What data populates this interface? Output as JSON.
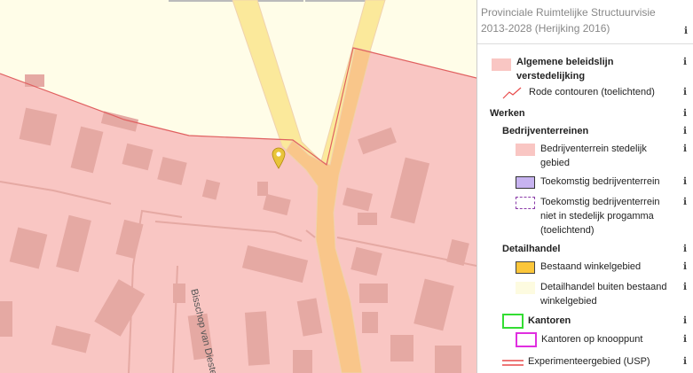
{
  "panel": {
    "title": "Provinciale Ruimtelijke Structuurvisie 2013-2028 (Herijking 2016)",
    "info_glyph": "ℹ"
  },
  "legend": [
    {
      "id": "beleidslijn",
      "label": "Algemene beleidslijn verstedelijking",
      "bold": true,
      "swatch": "fill",
      "color": "#f9c6c3"
    },
    {
      "id": "rode-contouren",
      "label": "Rode contouren (toelichtend)",
      "bold": false,
      "swatch": "line",
      "color": "#e84a4a"
    },
    {
      "id": "werken",
      "label": "Werken",
      "bold": true,
      "swatch": "none"
    },
    {
      "id": "bedrijventerreinen",
      "label": "Bedrijventerreinen",
      "bold": true,
      "swatch": "none"
    },
    {
      "id": "bedrijventerrein-stedelijk",
      "label": "Bedrijventerrein stedelijk gebied",
      "bold": false,
      "swatch": "fill",
      "color": "#f9c6c3"
    },
    {
      "id": "toekomstig-bedrijventerrein",
      "label": "Toekomstig bedrijventerrein",
      "bold": false,
      "swatch": "fill-border",
      "color": "#c7b3f0",
      "border": "#333333"
    },
    {
      "id": "toekomstig-niet-stedelijk",
      "label": "Toekomstig bedrijventerrein niet in stedelijk progamma (toelichtend)",
      "bold": false,
      "swatch": "dashed",
      "color": "#8a3ba8"
    },
    {
      "id": "detailhandel",
      "label": "Detailhandel",
      "bold": true,
      "swatch": "none"
    },
    {
      "id": "bestaand-winkelgebied",
      "label": "Bestaand winkelgebied",
      "bold": false,
      "swatch": "fill-border",
      "color": "#fbc63a",
      "border": "#444444"
    },
    {
      "id": "detailhandel-buiten",
      "label": "Detailhandel buiten bestaand winkelgebied",
      "bold": false,
      "swatch": "fill",
      "color": "#fdfbe0"
    },
    {
      "id": "kantoren",
      "label": "Kantoren",
      "bold": true,
      "swatch": "outline",
      "color": "#33dd33"
    },
    {
      "id": "kantoren-knooppunt",
      "label": "Kantoren op knooppunt",
      "bold": false,
      "swatch": "outline",
      "color": "#e02ee0"
    },
    {
      "id": "experimenteergebied",
      "label": "Experimenteergebied (USP)",
      "bold": false,
      "swatch": "double-line",
      "color": "#e84a4a"
    }
  ],
  "map": {
    "street_label": "Bisschop van Dieste",
    "colors": {
      "base": "#fffde8",
      "zone": "#f9c6c3",
      "contour": "#e06060",
      "building": "#e5a9a3",
      "road_yellow": "#fbe99b",
      "road_orange": "#f9c68a",
      "road_edge": "#f0d2ae",
      "marker": "#e8c43a"
    }
  }
}
